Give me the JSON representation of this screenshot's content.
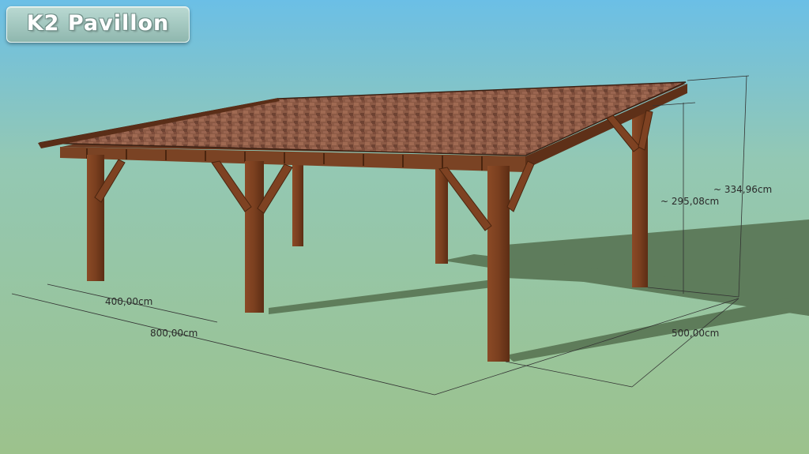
{
  "title": "K2 Pavillon",
  "dimensions": {
    "width_half": "400,00cm",
    "width_full": "800,00cm",
    "depth": "500,00cm",
    "height_low": "~ 295,08cm",
    "height_high": "~ 334,96cm"
  },
  "colors": {
    "sky_top": "#6bbfe6",
    "ground": "#9ec28f",
    "roof": "#8a5844",
    "wood": "#7a3f1f",
    "shadow": "#4f6b4a"
  }
}
